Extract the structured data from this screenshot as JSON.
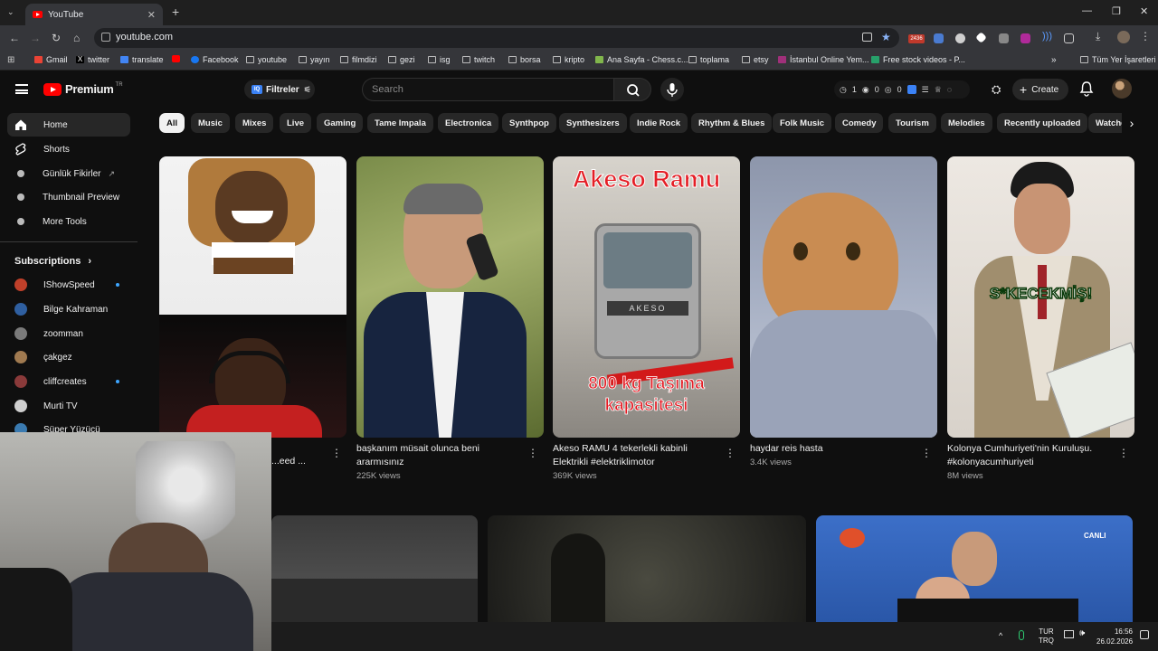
{
  "browser": {
    "tab_title": "YouTube",
    "url": "youtube.com",
    "extension_badge": "2436",
    "bookmarks": [
      {
        "label": "Gmail",
        "icon": "gmail-icon"
      },
      {
        "label": "twitter",
        "icon": "x-icon"
      },
      {
        "label": "translate",
        "icon": "translate-icon"
      },
      {
        "label": "",
        "icon": "youtube-icon"
      },
      {
        "label": "Facebook",
        "icon": "facebook-icon"
      },
      {
        "label": "youtube",
        "icon": "folder-icon"
      },
      {
        "label": "yayın",
        "icon": "folder-icon"
      },
      {
        "label": "filmdizi",
        "icon": "folder-icon"
      },
      {
        "label": "gezi",
        "icon": "folder-icon"
      },
      {
        "label": "isg",
        "icon": "folder-icon"
      },
      {
        "label": "twitch",
        "icon": "folder-icon"
      },
      {
        "label": "borsa",
        "icon": "folder-icon"
      },
      {
        "label": "kripto",
        "icon": "folder-icon"
      },
      {
        "label": "Ana Sayfa - Chess.c...",
        "icon": "chess-icon"
      },
      {
        "label": "toplama",
        "icon": "folder-icon"
      },
      {
        "label": "etsy",
        "icon": "folder-icon"
      },
      {
        "label": "İstanbul Online Yem...",
        "icon": "yahoo-icon"
      },
      {
        "label": "Free stock videos - P...",
        "icon": "pexels-icon"
      }
    ],
    "all_bookmarks": "Tüm Yer İşaretleri"
  },
  "masthead": {
    "logo": "Premium",
    "country": "TR",
    "filter_label": "Filtreler",
    "search_placeholder": "Search",
    "stats": [
      "1",
      "0",
      "0"
    ],
    "create_label": "Create"
  },
  "sidebar": {
    "items": [
      {
        "label": "Home",
        "icon": "home-icon"
      },
      {
        "label": "Shorts",
        "icon": "shorts-icon"
      },
      {
        "label": "Günlük Fikirler",
        "icon": "bulb-icon"
      },
      {
        "label": "Thumbnail Preview",
        "icon": "preview-icon"
      },
      {
        "label": "More Tools",
        "icon": "tools-icon"
      }
    ],
    "subscriptions_title": "Subscriptions",
    "subscriptions": [
      {
        "label": "IShowSpeed",
        "color": "#c0402a",
        "dot": true
      },
      {
        "label": "Bilge Kahraman",
        "color": "#2f5fa0",
        "dot": false
      },
      {
        "label": "zoomman",
        "color": "#7a7a7a",
        "dot": false
      },
      {
        "label": "çakgez",
        "color": "#a07a50",
        "dot": false
      },
      {
        "label": "cliffcreates",
        "color": "#8a3a3a",
        "dot": true
      },
      {
        "label": "Murti TV",
        "color": "#cfcfcf",
        "dot": false
      },
      {
        "label": "Süper Yüzücü",
        "color": "#3a7ab0",
        "dot": false
      }
    ]
  },
  "chips": [
    "All",
    "Music",
    "Mixes",
    "Live",
    "Gaming",
    "Tame Impala",
    "Electronica",
    "Synthpop",
    "Synthesizers",
    "Indie Rock",
    "Rhythm & Blues",
    "Folk Music",
    "Comedy",
    "Tourism",
    "Melodies",
    "Recently uploaded",
    "Watched"
  ],
  "videos": [
    {
      "title": "...eed ...",
      "views": ""
    },
    {
      "title": "başkanım müsait olunca beni ararmısınız",
      "views": "225K views"
    },
    {
      "title": "Akeso RAMU 4 tekerlekli kabinli Elektrikli #elektriklimotor",
      "views": "369K views",
      "overlay_top": "Akeso Ramu",
      "overlay_bottom": "800 kg Taşıma kapasitesi"
    },
    {
      "title": "haydar reis hasta",
      "views": "3.4K views"
    },
    {
      "title": "Kolonya Cumhuriyeti'nin Kuruluşu. #kolonyacumhuriyeti",
      "views": "8M views",
      "overlay": "S*KECEKMİŞ!"
    }
  ],
  "row2_tags": {
    "canli": "CANLI"
  },
  "taskbar": {
    "lang_top": "TUR",
    "lang_bottom": "TRQ",
    "time": "16:56",
    "date": "26.02.2026"
  }
}
